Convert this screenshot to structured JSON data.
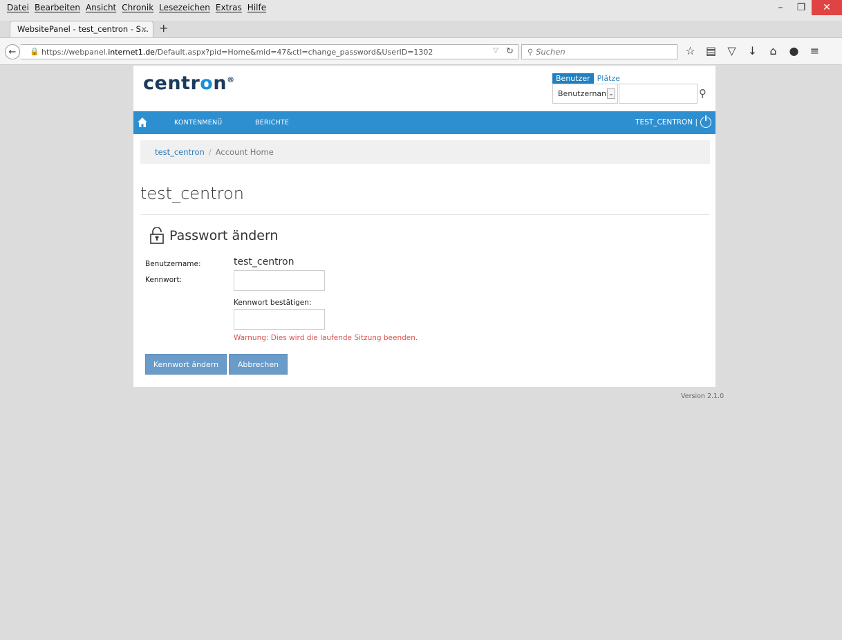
{
  "browser": {
    "menus": [
      "Datei",
      "Bearbeiten",
      "Ansicht",
      "Chronik",
      "Lesezeichen",
      "Extras",
      "Hilfe"
    ],
    "tab_title": "WebsitePanel - test_centron - S...",
    "tab_close": "×",
    "new_tab": "+",
    "url_prefix": "https://webpanel.",
    "url_host": "internet1.de",
    "url_path": "/Default.aspx?pid=Home&mid=47&ctl=change_password&UserID=1302",
    "search_placeholder": "Suchen",
    "win_minimize": "–",
    "win_restore": "❐",
    "win_close": "✕"
  },
  "header": {
    "logo_prefix": "centr",
    "logo_o": "o",
    "logo_suffix": "n",
    "logo_mark": "®",
    "tab_active": "Benutzer",
    "tab_other": "Plätze",
    "select_value": "Benutzernan"
  },
  "nav": {
    "menu1": "KONTENMENÜ",
    "menu2": "BERICHTE",
    "user": "TEST_CENTRON |"
  },
  "breadcrumb": {
    "link": "test_centron",
    "sep": "/",
    "current": "Account Home"
  },
  "page_title": "test_centron",
  "form": {
    "title": "Passwort ändern",
    "username_label": "Benutzername:",
    "username_value": "test_centron",
    "password_label": "Kennwort:",
    "confirm_label": "Kennwort bestätigen:",
    "warning": "Warnung: Dies wird die laufende Sitzung beenden.",
    "submit_label": "Kennwort ändern",
    "cancel_label": "Abbrechen"
  },
  "footer": {
    "version": "Version 2.1.0"
  },
  "colors": {
    "navbar_blue": "#2e8fd0",
    "button_blue": "#6a9bc9",
    "warning_red": "#d9534f",
    "logo_dark": "#1b3a5c",
    "logo_accent": "#1c8ed8"
  }
}
